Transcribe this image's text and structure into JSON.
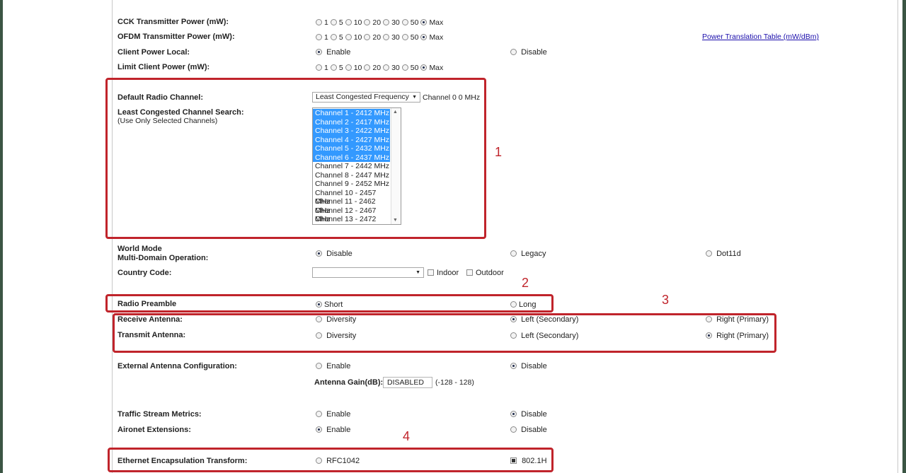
{
  "tx_power_opts": [
    "1",
    "5",
    "10",
    "20",
    "30",
    "50",
    "Max"
  ],
  "rows": {
    "cck": {
      "label": "CCK Transmitter Power (mW):",
      "selected": "Max"
    },
    "ofdm": {
      "label": "OFDM Transmitter Power (mW):",
      "selected": "Max",
      "link": "Power Translation Table (mW/dBm)"
    },
    "client_power_local": {
      "label": "Client Power Local:",
      "enable": "Enable",
      "disable": "Disable",
      "selected": "Enable"
    },
    "limit_client_power": {
      "label": "Limit Client Power (mW):",
      "selected": "Max"
    }
  },
  "channel": {
    "label": "Default Radio Channel:",
    "select_value": "Least Congested Frequency",
    "suffix": "Channel 0 0 MHz",
    "search_label": "Least Congested Channel Search:",
    "search_sub": "(Use Only Selected Channels)",
    "list": [
      {
        "text": "Channel 1 - 2412 MHz",
        "selected": true
      },
      {
        "text": "Channel 2 - 2417 MHz",
        "selected": true
      },
      {
        "text": "Channel 3 - 2422 MHz",
        "selected": true
      },
      {
        "text": "Channel 4 - 2427 MHz",
        "selected": true
      },
      {
        "text": "Channel 5 - 2432 MHz",
        "selected": true
      },
      {
        "text": "Channel 6 - 2437 MHz",
        "selected": true
      },
      {
        "text": "Channel 7 - 2442 MHz",
        "selected": false
      },
      {
        "text": "Channel 8 - 2447 MHz",
        "selected": false
      },
      {
        "text": "Channel 9 - 2452 MHz",
        "selected": false
      },
      {
        "text": "Channel 10 - 2457 MHz",
        "selected": false
      },
      {
        "text": "Channel 11 - 2462 MHz",
        "selected": false
      },
      {
        "text": "Channel 12 - 2467 MHz",
        "selected": false
      },
      {
        "text": "Channel 13 - 2472 MHz",
        "selected": false
      }
    ]
  },
  "world_mode": {
    "label1": "World Mode",
    "label2": "Multi-Domain Operation:",
    "opts": [
      "Disable",
      "Legacy",
      "Dot11d"
    ],
    "selected": "Disable"
  },
  "country": {
    "label": "Country Code:",
    "value": "",
    "indoor": "Indoor",
    "outdoor": "Outdoor"
  },
  "preamble": {
    "label": "Radio Preamble",
    "short": "Short",
    "long": "Long",
    "selected": "Short"
  },
  "receive_antenna": {
    "label": "Receive Antenna:",
    "opts": [
      "Diversity",
      "Left (Secondary)",
      "Right (Primary)"
    ],
    "selected": "Left (Secondary)"
  },
  "transmit_antenna": {
    "label": "Transmit Antenna:",
    "opts": [
      "Diversity",
      "Left (Secondary)",
      "Right (Primary)"
    ],
    "selected": "Right (Primary)"
  },
  "ext_antenna": {
    "label": "External Antenna Configuration:",
    "enable": "Enable",
    "disable": "Disable",
    "selected": "Disable",
    "gain_label": "Antenna Gain(dB):",
    "gain_value": "DISABLED",
    "gain_range": "(-128 - 128)"
  },
  "traffic_stream": {
    "label": "Traffic Stream Metrics:",
    "enable": "Enable",
    "disable": "Disable",
    "selected": "Disable"
  },
  "aironet": {
    "label": "Aironet Extensions:",
    "enable": "Enable",
    "disable": "Disable",
    "selected": "Enable"
  },
  "ethernet": {
    "label": "Ethernet Encapsulation Transform:",
    "opt1": "RFC1042",
    "opt2": "802.1H",
    "selected": "802.1H"
  },
  "annotations": [
    "1",
    "2",
    "3",
    "4"
  ],
  "colors": {
    "highlight": "#c0242b",
    "list_selected": "#3399ff",
    "frame": "#3b5544"
  }
}
